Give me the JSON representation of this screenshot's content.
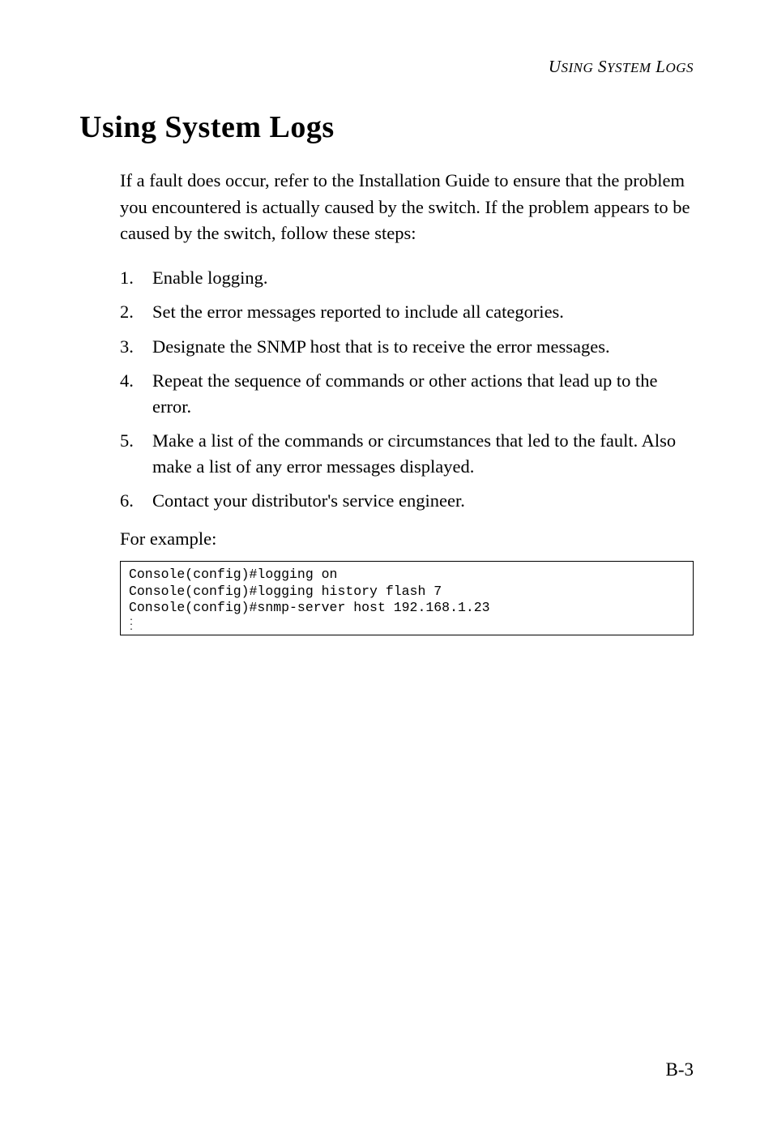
{
  "header": {
    "text": "USING SYSTEM LOGS"
  },
  "title": "Using System Logs",
  "intro": "If a fault does occur, refer to the Installation Guide to ensure that the problem you encountered is actually caused by the switch. If the problem appears to be caused by the switch, follow these steps:",
  "steps": [
    "Enable logging.",
    "Set the error messages reported to include all categories.",
    "Designate the SNMP host that is to receive the error messages.",
    "Repeat the sequence of commands or other actions that lead up to the error.",
    "Make a list of the commands or circumstances that led to the fault. Also make a list of any error messages displayed.",
    "Contact your distributor's service engineer."
  ],
  "for_example": "For example:",
  "code": {
    "line1": "Console(config)#logging on",
    "line2": "Console(config)#logging history flash 7",
    "line3": "Console(config)#snmp-server host 192.168.1.23"
  },
  "page_number": "B-3"
}
